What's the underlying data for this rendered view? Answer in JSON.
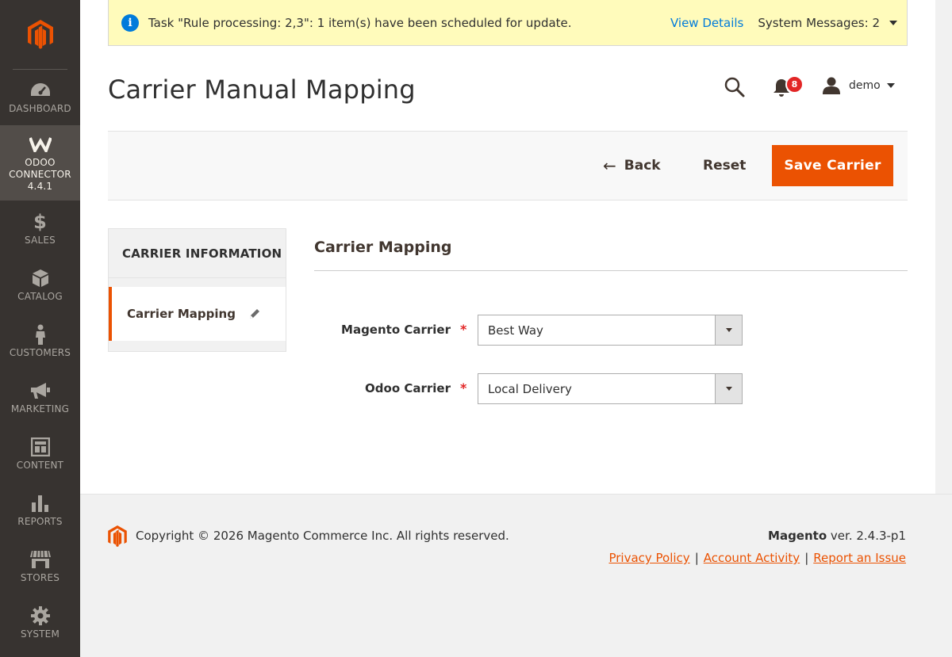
{
  "sidebar": {
    "items": [
      {
        "label": "DASHBOARD",
        "icon": "dashboard-icon"
      },
      {
        "label": "ODOO",
        "label2": "CONNECTOR",
        "label3": "4.4.1",
        "icon": "odoo-connector-icon",
        "active": true
      },
      {
        "label": "SALES",
        "icon": "dollar-icon"
      },
      {
        "label": "CATALOG",
        "icon": "cube-icon"
      },
      {
        "label": "CUSTOMERS",
        "icon": "person-icon"
      },
      {
        "label": "MARKETING",
        "icon": "megaphone-icon"
      },
      {
        "label": "CONTENT",
        "icon": "layout-icon"
      },
      {
        "label": "REPORTS",
        "icon": "bar-chart-icon"
      },
      {
        "label": "STORES",
        "icon": "storefront-icon"
      },
      {
        "label": "SYSTEM",
        "icon": "gear-icon"
      }
    ]
  },
  "message": {
    "text": "Task \"Rule processing: 2,3\": 1 item(s) have been scheduled for update.",
    "view_details": "View Details",
    "system_messages": "System Messages: 2"
  },
  "header": {
    "title": "Carrier Manual Mapping",
    "notification_count": "8",
    "user": "demo"
  },
  "actions": {
    "back": "Back",
    "reset": "Reset",
    "save": "Save Carrier"
  },
  "tabs": {
    "heading": "CARRIER INFORMATION",
    "items": [
      {
        "label": "Carrier Mapping"
      }
    ]
  },
  "form": {
    "section_title": "Carrier Mapping",
    "fields": [
      {
        "label": "Magento Carrier",
        "value": "Best Way",
        "required": "*"
      },
      {
        "label": "Odoo Carrier",
        "value": "Local Delivery",
        "required": "*"
      }
    ]
  },
  "footer": {
    "copyright": "Copyright © 2026 Magento Commerce Inc. All rights reserved.",
    "brand": "Magento",
    "version": "ver. 2.4.3-p1",
    "links": [
      "Privacy Policy",
      "Account Activity",
      "Report an Issue"
    ],
    "separator": "|"
  },
  "colors": {
    "accent": "#eb5202",
    "sidebar": "#373330",
    "link": "#007bdb",
    "message_bg": "#fffbbb",
    "badge": "#e22626"
  }
}
